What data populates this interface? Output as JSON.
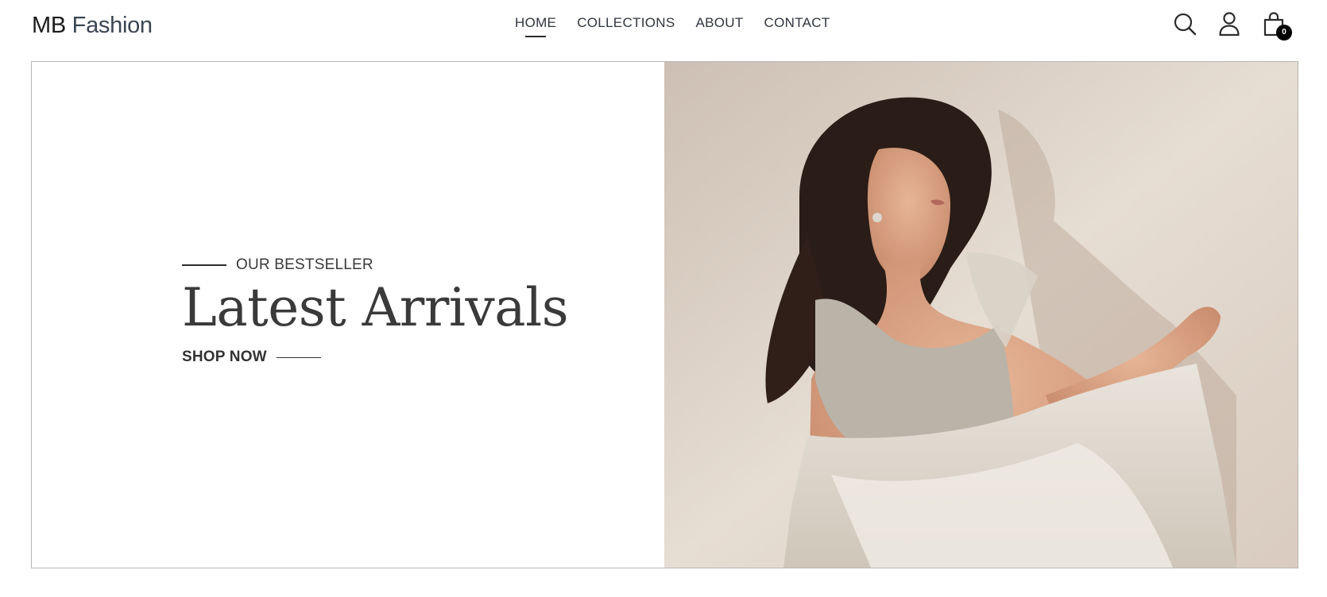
{
  "brand": {
    "part1": "MB",
    "part2": "Fashion"
  },
  "nav": {
    "items": [
      {
        "label": "HOME",
        "active": true
      },
      {
        "label": "COLLECTIONS",
        "active": false
      },
      {
        "label": "ABOUT",
        "active": false
      },
      {
        "label": "CONTACT",
        "active": false
      }
    ]
  },
  "header_icons": {
    "search": "search-icon",
    "account": "user-icon",
    "cart": "shopping-bag-icon",
    "cart_count": "0"
  },
  "hero": {
    "eyebrow": "OUR BESTSELLER",
    "title": "Latest Arrivals",
    "cta": "SHOP NOW",
    "image": "woman-in-white-organza-saree-photo"
  },
  "colors": {
    "text": "#2b2b2b",
    "logo_accent": "#3b4552",
    "border": "#b8b8b8",
    "badge": "#000000"
  }
}
